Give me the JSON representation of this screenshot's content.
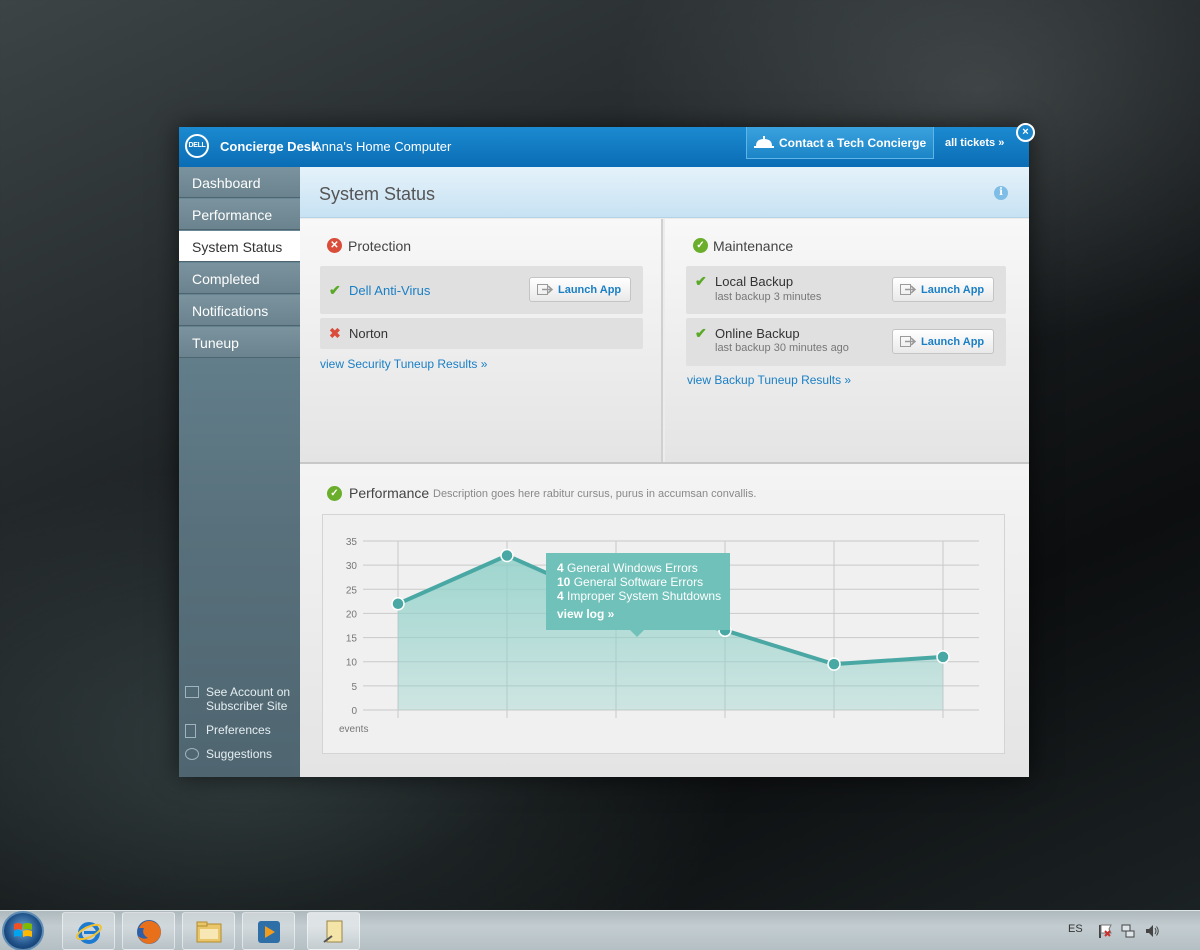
{
  "window": {
    "logo_text": "DELL",
    "app_name": "Concierge Desk",
    "computer_name": "Anna's Home Computer",
    "contact_label": "Contact a Tech Concierge",
    "all_tickets_label": "all tickets »",
    "close_symbol": "×"
  },
  "sidebar": {
    "items": [
      {
        "label": "Dashboard"
      },
      {
        "label": "Performance"
      },
      {
        "label": "System Status",
        "active": true
      },
      {
        "label": "Completed"
      },
      {
        "label": "Notifications"
      },
      {
        "label": "Tuneup"
      }
    ],
    "footer_links": [
      {
        "label": "See Account on Subscriber Site",
        "icon": "browser-window-icon"
      },
      {
        "label": "Preferences",
        "icon": "document-icon"
      },
      {
        "label": "Suggestions",
        "icon": "speech-bubble-icon"
      }
    ]
  },
  "page": {
    "title": "System Status",
    "info_symbol": "i"
  },
  "protection": {
    "title": "Protection",
    "status": "error",
    "rows": [
      {
        "name": "Dell Anti-Virus",
        "status": "ok",
        "button": "Launch App"
      },
      {
        "name": "Norton",
        "status": "error"
      }
    ],
    "link": "view Security Tuneup Results »"
  },
  "maintenance": {
    "title": "Maintenance",
    "status": "ok",
    "rows": [
      {
        "name": "Local Backup",
        "sub": "last backup 3 minutes",
        "status": "ok",
        "button": "Launch App"
      },
      {
        "name": "Online Backup",
        "sub": "last backup 30 minutes ago",
        "status": "ok",
        "button": "Launch App"
      }
    ],
    "link": "view Backup Tuneup Results »"
  },
  "performance": {
    "title": "Performance",
    "description": "Description goes here rabitur cursus, purus in accumsan convallis.",
    "tooltip": {
      "lines": [
        {
          "count": "4",
          "text": "General Windows Errors"
        },
        {
          "count": "10",
          "text": "General Software Errors"
        },
        {
          "count": "4",
          "text": "Improper System Shutdowns"
        }
      ],
      "link": "view log »"
    }
  },
  "chart_data": {
    "type": "area",
    "x": [
      1,
      2,
      3,
      4,
      5,
      6
    ],
    "values": [
      22,
      32,
      22,
      16.5,
      9.5,
      11
    ],
    "ylim": [
      0,
      35
    ],
    "yticks": [
      0,
      5,
      10,
      15,
      20,
      25,
      30,
      35
    ],
    "ylabel": "events",
    "xlabel": "",
    "grid": true,
    "highlighted_index": 2,
    "colors": {
      "line": "#4aa8a4",
      "fill": "#8fd0c8",
      "point": "#4aa8a4"
    }
  },
  "taskbar": {
    "language": "ES",
    "pinned": [
      {
        "icon": "internet-explorer-icon"
      },
      {
        "icon": "firefox-icon"
      },
      {
        "icon": "explorer-folder-icon"
      },
      {
        "icon": "media-player-icon"
      },
      {
        "icon": "notepad-icon"
      }
    ],
    "tray": [
      {
        "icon": "action-center-flag-icon"
      },
      {
        "icon": "network-icon"
      },
      {
        "icon": "volume-icon"
      }
    ]
  }
}
